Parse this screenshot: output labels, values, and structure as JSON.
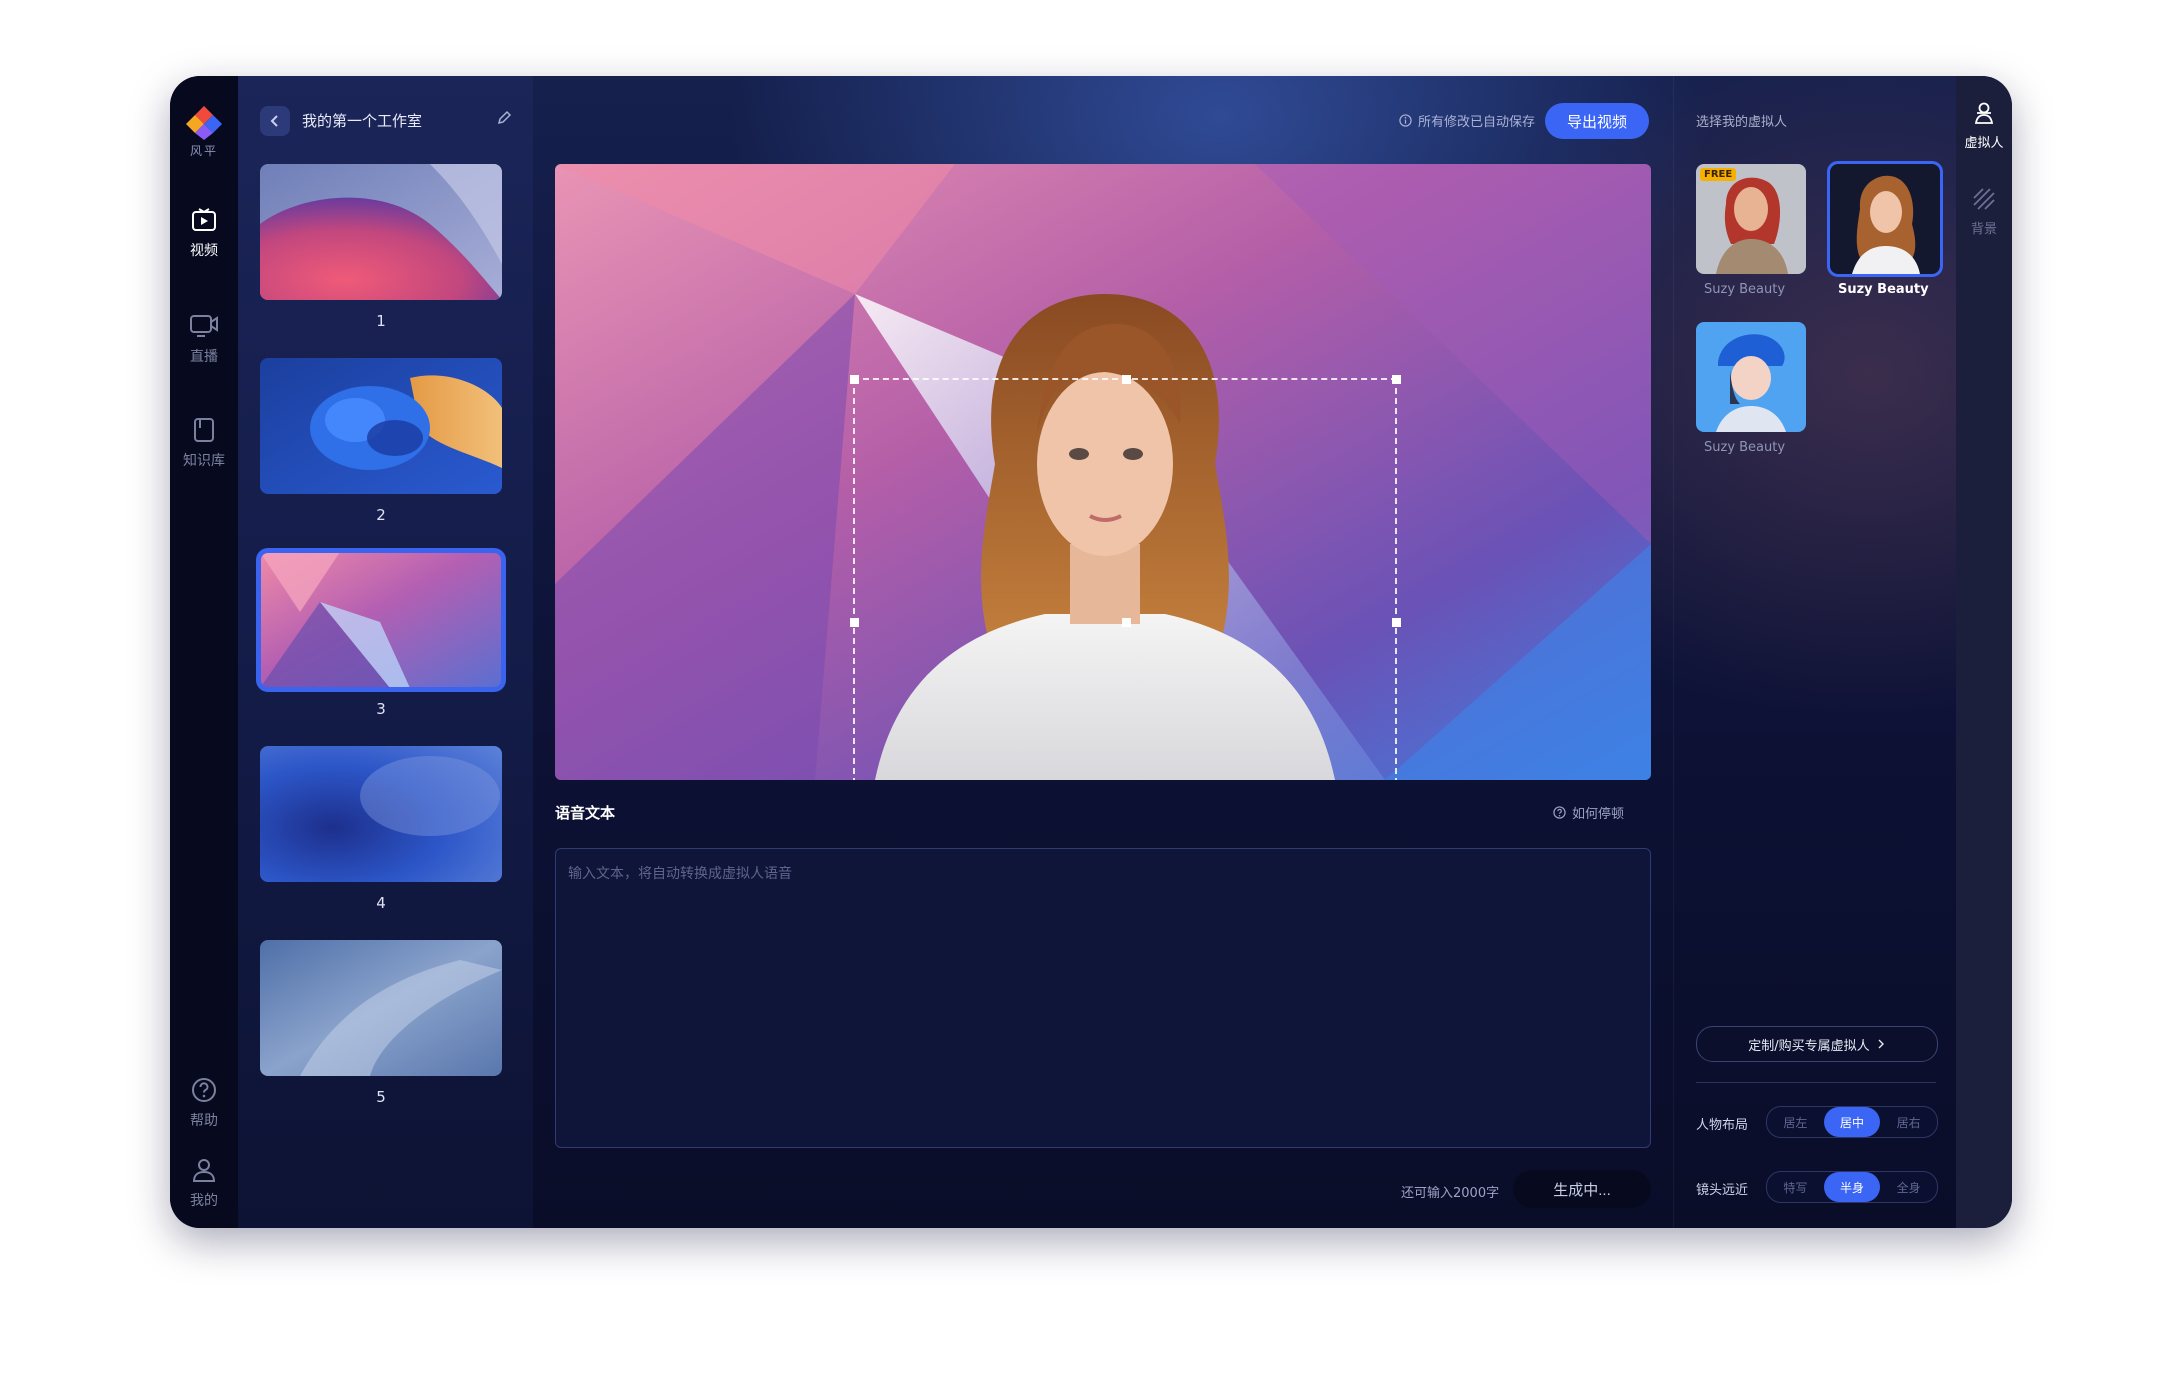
{
  "brand": {
    "logo_text": "风平"
  },
  "nav": {
    "items": [
      {
        "label": "视频"
      },
      {
        "label": "直播"
      },
      {
        "label": "知识库"
      },
      {
        "label": "帮助"
      },
      {
        "label": "我的"
      }
    ]
  },
  "studio": {
    "title": "我的第一个工作室"
  },
  "slides": {
    "items": [
      {
        "number": "1"
      },
      {
        "number": "2"
      },
      {
        "number": "3"
      },
      {
        "number": "4"
      },
      {
        "number": "5"
      }
    ],
    "selected_index": 3
  },
  "header": {
    "autosave_text": "所有修改已自动保存",
    "export_label": "导出视频"
  },
  "editor": {
    "voice_label": "语音文本",
    "pause_help": "如何停顿",
    "text_placeholder": "输入文本，将自动转换成虚拟人语音",
    "text_value": "",
    "remaining": "还可输入2000字",
    "generate_label": "生成中..."
  },
  "avatars": {
    "title": "选择我的虚拟人",
    "items": [
      {
        "name": "Suzy Beauty",
        "badge": "FREE",
        "selected": false
      },
      {
        "name": "Suzy Beauty",
        "badge": "",
        "selected": true
      },
      {
        "name": "Suzy Beauty",
        "badge": "",
        "selected": false
      }
    ],
    "custom_label": "定制/购买专属虚拟人"
  },
  "layout_control": {
    "label": "人物布局",
    "options": [
      "居左",
      "居中",
      "居右"
    ],
    "selected": "居中"
  },
  "camera_control": {
    "label": "镜头远近",
    "options": [
      "特写",
      "半身",
      "全身"
    ],
    "selected": "半身"
  },
  "right_rail": {
    "items": [
      {
        "label": "虚拟人"
      },
      {
        "label": "背景"
      }
    ]
  },
  "colors": {
    "accent": "#3b66f5",
    "rail_bg": "#070a1f",
    "free_badge": "#f5b000"
  }
}
